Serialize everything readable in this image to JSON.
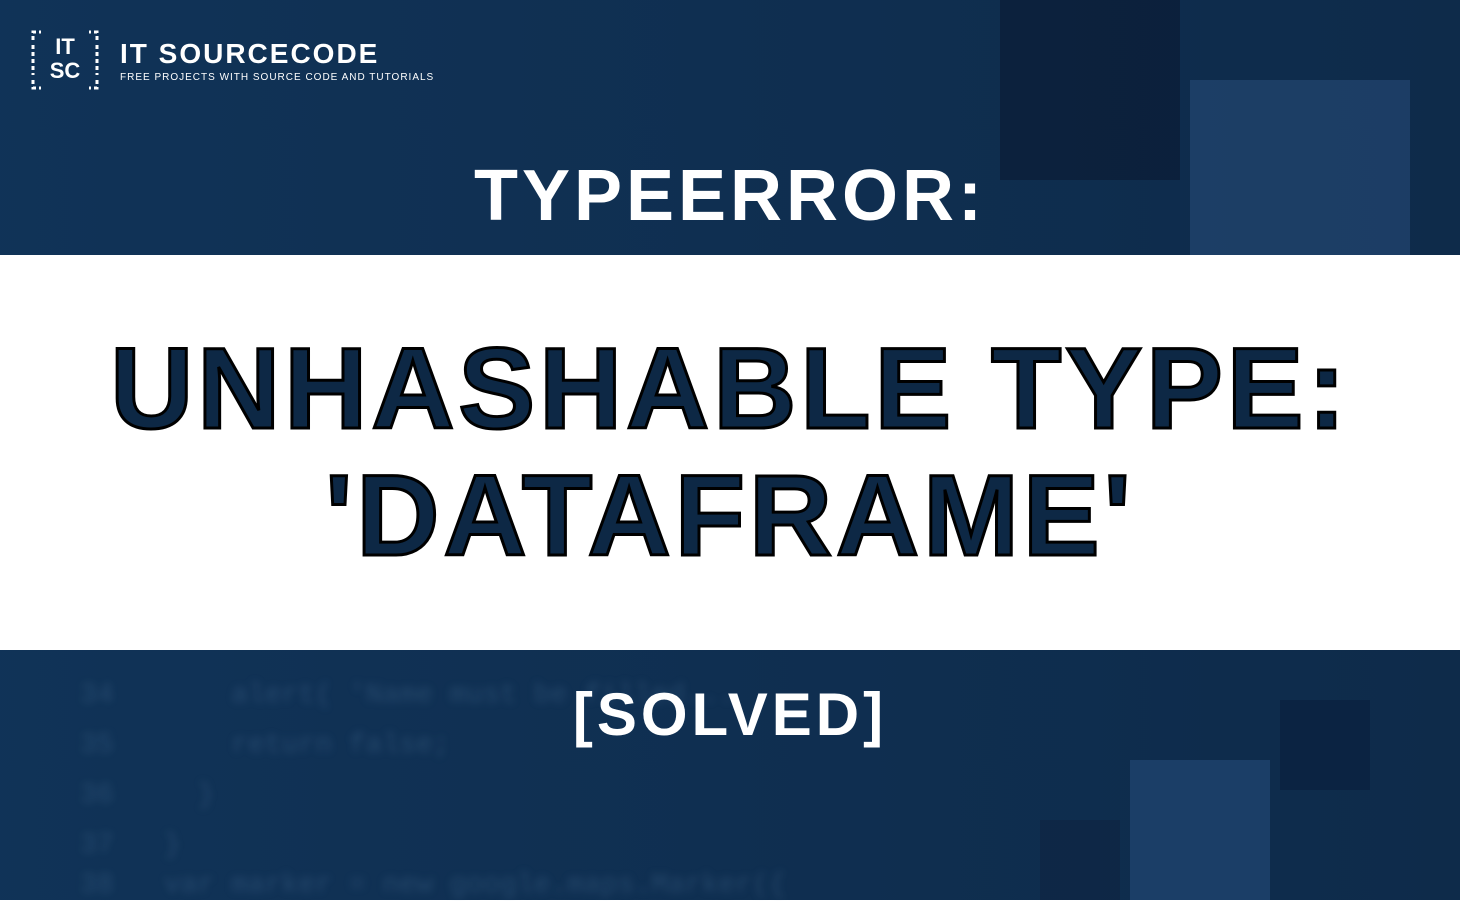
{
  "logo": {
    "title": "IT SOURCECODE",
    "subtitle": "FREE PROJECTS WITH SOURCE CODE AND TUTORIALS"
  },
  "header": "TYPEERROR:",
  "banner": {
    "line1": "UNHASHABLE TYPE:",
    "line2": "'DATAFRAME'"
  },
  "footer": "[SOLVED]",
  "bg_code_lines": [
    {
      "num": "34",
      "text": "alert( 'Name must be filled..."
    },
    {
      "num": "35",
      "text": "return false;"
    },
    {
      "num": "36",
      "text": "}"
    },
    {
      "num": "37",
      "text": "}"
    },
    {
      "num": "38",
      "text": "var marker = new google.maps.Marker({"
    }
  ]
}
